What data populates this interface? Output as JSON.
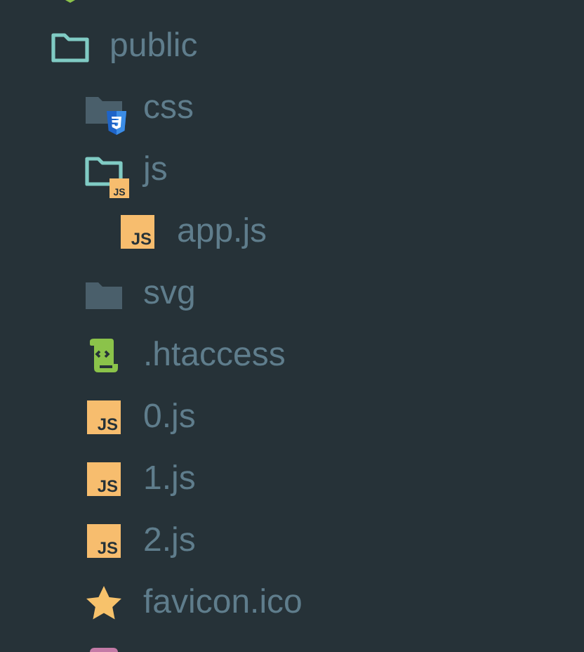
{
  "tree": [
    {
      "kind": "node"
    },
    {
      "kind": "folder",
      "name": "public",
      "expanded": true,
      "children": [
        {
          "kind": "folder",
          "name": "css",
          "expanded": false,
          "badge": {
            "kind": "css"
          }
        },
        {
          "kind": "folder",
          "name": "js",
          "expanded": true,
          "badge": {
            "kind": "js",
            "text": "JS"
          },
          "children": [
            {
              "kind": "js",
              "name": "app.js",
              "badge_text": "JS"
            }
          ]
        },
        {
          "kind": "folder",
          "name": "svg",
          "expanded": false
        },
        {
          "kind": "config",
          "name": ".htaccess"
        },
        {
          "kind": "js",
          "name": "0.js",
          "badge_text": "JS"
        },
        {
          "kind": "js",
          "name": "1.js",
          "badge_text": "JS"
        },
        {
          "kind": "js",
          "name": "2.js",
          "badge_text": "JS"
        },
        {
          "kind": "favicon",
          "name": "favicon.ico"
        },
        {
          "kind": "markup"
        }
      ]
    }
  ]
}
